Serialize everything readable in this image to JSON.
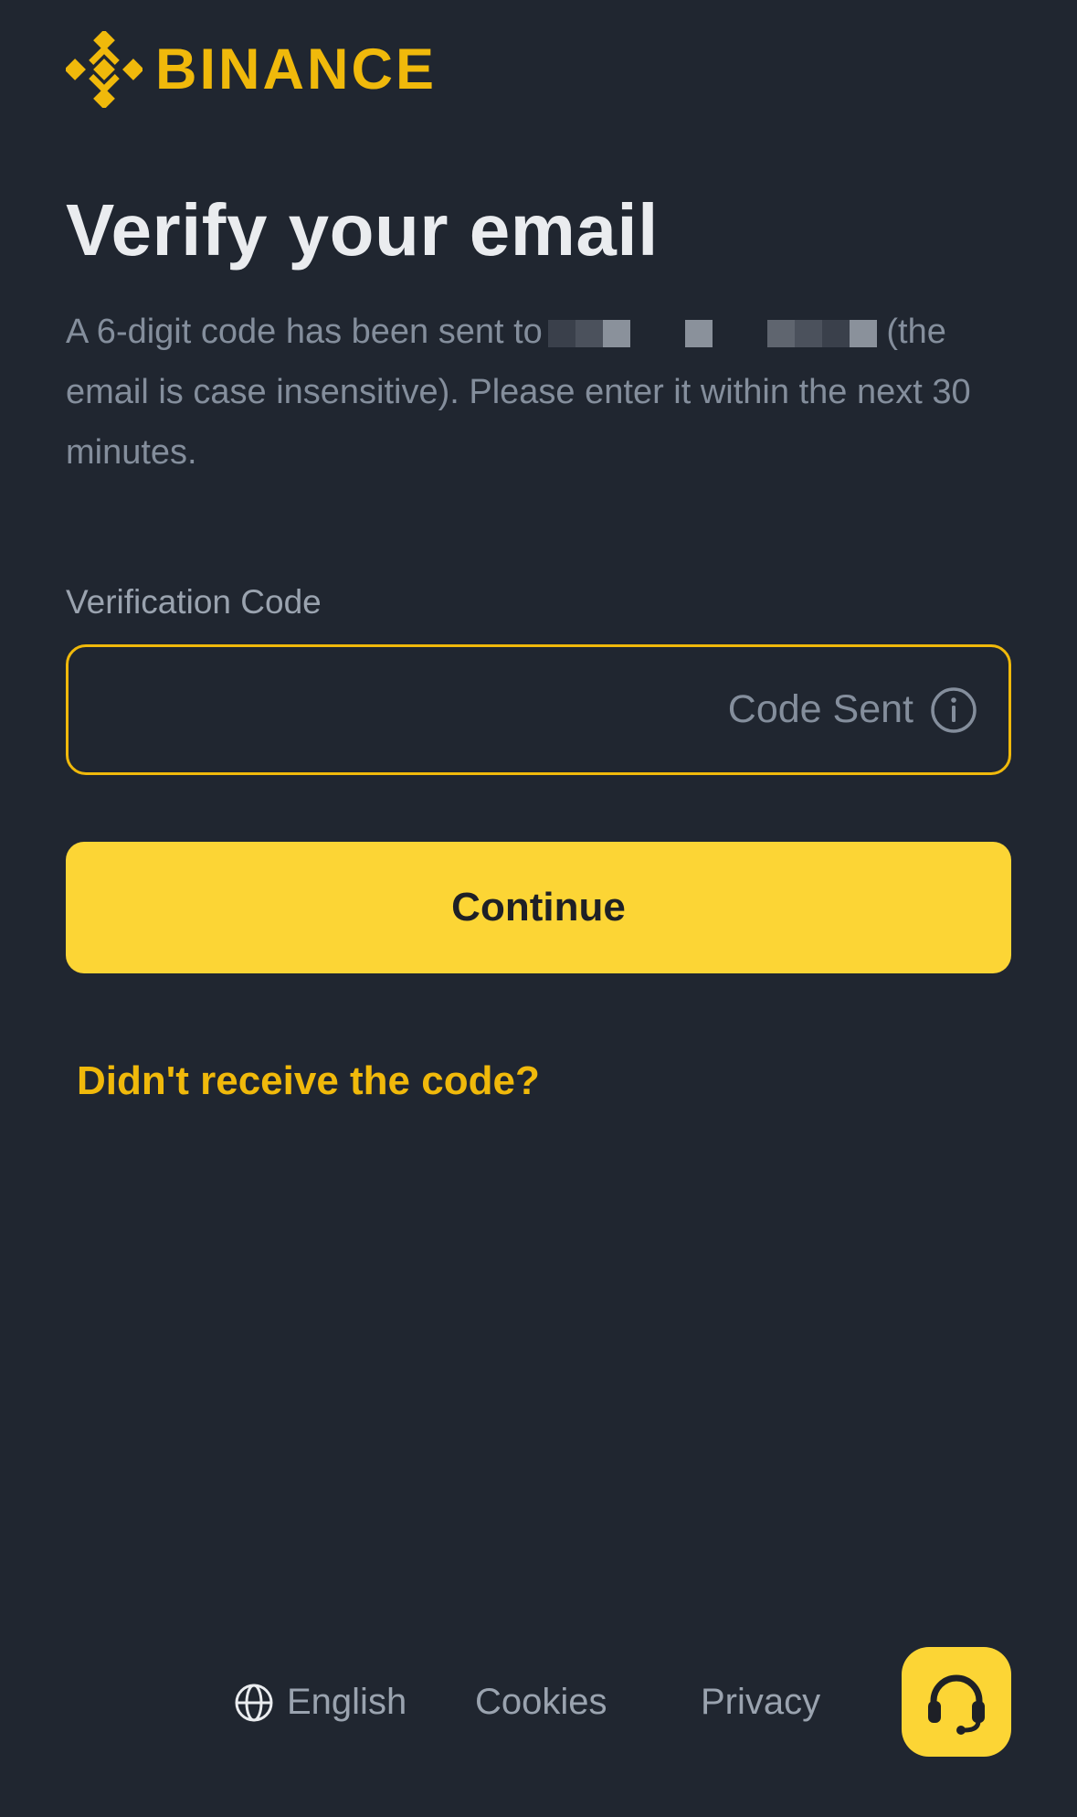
{
  "brand": {
    "name": "BINANCE",
    "color": "#f0b90b"
  },
  "heading": {
    "title": "Verify your email"
  },
  "description": {
    "prefix": "A 6-digit code has been sent to",
    "suffix": "(the email is case insensitive). Please enter it within the next 30 minutes."
  },
  "field": {
    "label": "Verification Code",
    "value": "",
    "placeholder": "",
    "status_text": "Code Sent",
    "status_icon": "info-icon"
  },
  "actions": {
    "continue_label": "Continue",
    "resend_label": "Didn't receive the code?"
  },
  "footer": {
    "language_label": "English",
    "language_icon": "globe-icon",
    "cookies_label": "Cookies",
    "privacy_label": "Privacy",
    "support_icon": "headset-icon"
  },
  "colors": {
    "background": "#202630",
    "accent": "#fcd535",
    "text_primary": "#eaecef",
    "text_secondary": "#848e9c"
  }
}
